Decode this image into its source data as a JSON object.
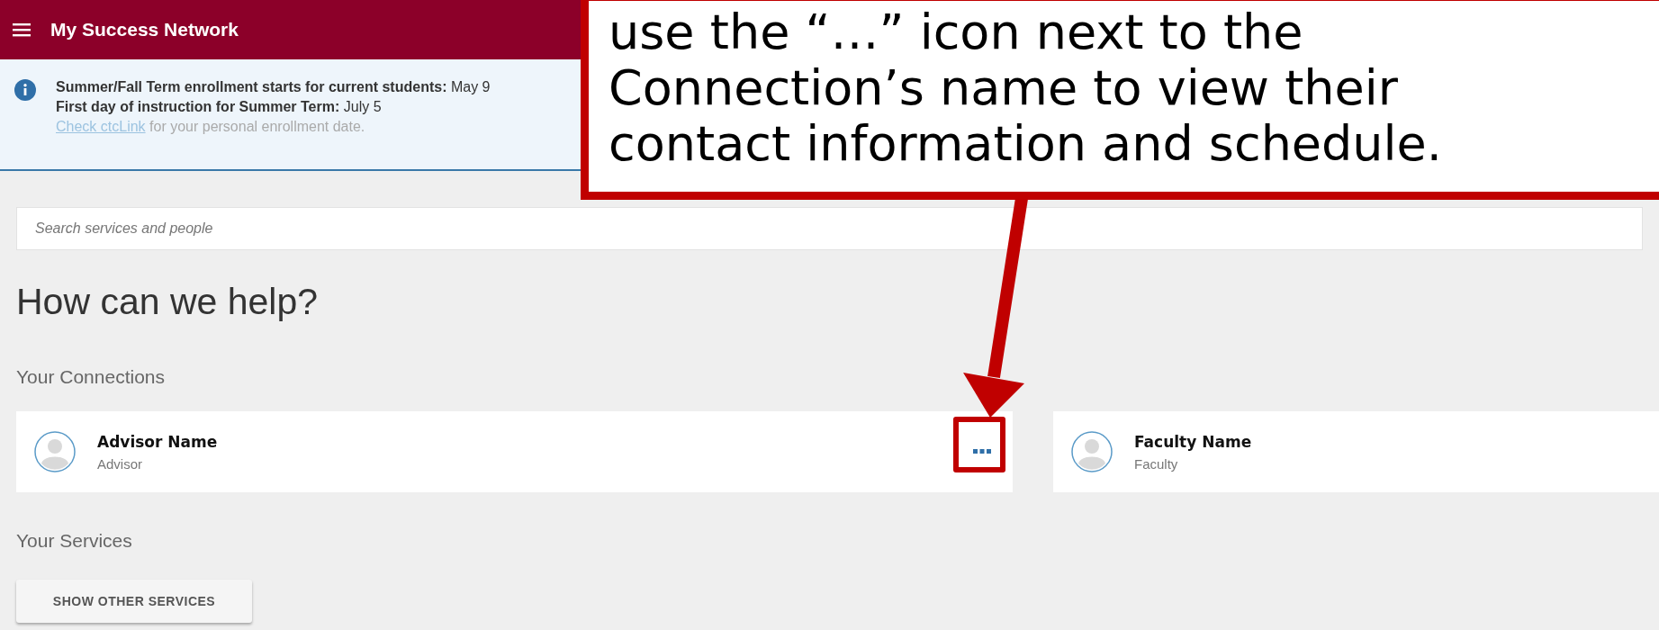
{
  "header": {
    "title": "My Success Network"
  },
  "banner": {
    "lines": [
      "**Summer/Fall Term enrollment starts for current students:** May 9",
      "**First day of instruction for Summer Term:** July 5"
    ],
    "link": "Check ctcLink",
    "note": " for your personal enrollment date."
  },
  "search": {
    "placeholder": "Search services and people"
  },
  "heading": "How can we help?",
  "connections": {
    "title": "Your Connections",
    "items": [
      {
        "name": "Advisor Name",
        "role": "Advisor",
        "menu_button": true,
        "highlighted": true
      },
      {
        "name": "Faculty Name",
        "role": "Faculty",
        "menu_button": false,
        "highlighted": false
      }
    ]
  },
  "services": {
    "title": "Your Services",
    "button": "SHOW OTHER SERVICES"
  },
  "callout": {
    "lines": [
      "use the “…” icon next to the",
      "Connection’s name to view their",
      "contact information and schedule."
    ]
  }
}
